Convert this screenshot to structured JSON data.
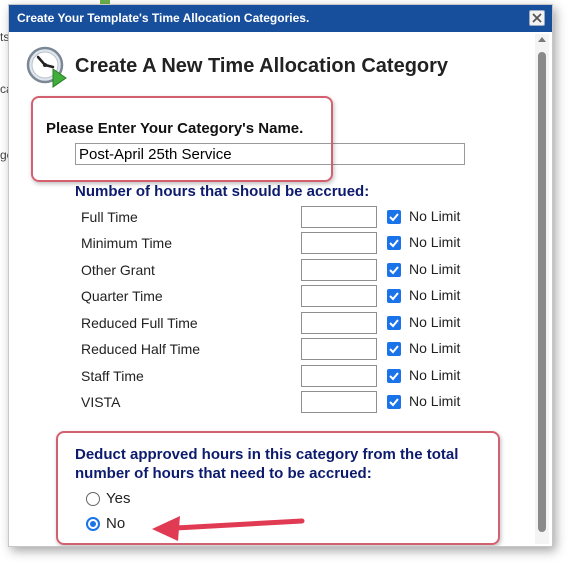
{
  "background": {
    "fragments": [
      "ts",
      "ca",
      "ge"
    ]
  },
  "dialog": {
    "title": "Create Your Template's Time Allocation Categories.",
    "heading": "Create A New Time Allocation Category",
    "name_label": "Please Enter Your Category's Name.",
    "name_value": "Post-April 25th Service",
    "hours_heading": "Number of hours that should be accrued:",
    "rows": [
      {
        "label": "Full Time",
        "hours": "",
        "no_limit": true,
        "no_limit_label": "No Limit"
      },
      {
        "label": "Minimum Time",
        "hours": "",
        "no_limit": true,
        "no_limit_label": "No Limit"
      },
      {
        "label": "Other Grant",
        "hours": "",
        "no_limit": true,
        "no_limit_label": "No Limit"
      },
      {
        "label": "Quarter Time",
        "hours": "",
        "no_limit": true,
        "no_limit_label": "No Limit"
      },
      {
        "label": "Reduced Full Time",
        "hours": "",
        "no_limit": true,
        "no_limit_label": "No Limit"
      },
      {
        "label": "Reduced Half Time",
        "hours": "",
        "no_limit": true,
        "no_limit_label": "No Limit"
      },
      {
        "label": "Staff Time",
        "hours": "",
        "no_limit": true,
        "no_limit_label": "No Limit"
      },
      {
        "label": "VISTA",
        "hours": "",
        "no_limit": true,
        "no_limit_label": "No Limit"
      }
    ],
    "deduct_heading": "Deduct approved hours in this category from the total number of hours that need to be accrued:",
    "deduct_options": [
      {
        "label": "Yes",
        "selected": false
      },
      {
        "label": "No",
        "selected": true
      }
    ]
  },
  "colors": {
    "titlebar": "#184f9c",
    "callout": "#d4606f",
    "accent": "#1a73e8",
    "heading_blue": "#0d1b6e"
  },
  "icons": {
    "header": "clock-play-icon",
    "close": "close-icon",
    "checkbox": "checkmark-icon",
    "annotation": "arrow-icon"
  }
}
